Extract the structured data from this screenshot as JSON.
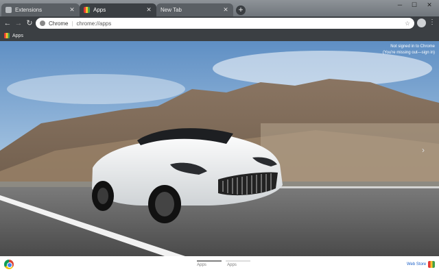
{
  "tabs": [
    {
      "label": "Extensions",
      "icon": "puzzle-icon"
    },
    {
      "label": "Apps",
      "icon": "apps-icon"
    },
    {
      "label": "New Tab",
      "icon": ""
    }
  ],
  "toolbar": {
    "site_label": "Chrome",
    "url": "chrome://apps"
  },
  "bookmarks": {
    "apps_label": "Apps"
  },
  "content": {
    "signin_line1": "Not signed in to Chrome",
    "signin_line2": "(You're missing out—sign in)"
  },
  "footer": {
    "pages": [
      "Apps",
      "Apps"
    ],
    "webstore_label": "Web Store"
  },
  "colors": {
    "tabstrip": "#6f757b",
    "toolbar": "#3b3f43",
    "link": "#1a5fc8"
  }
}
